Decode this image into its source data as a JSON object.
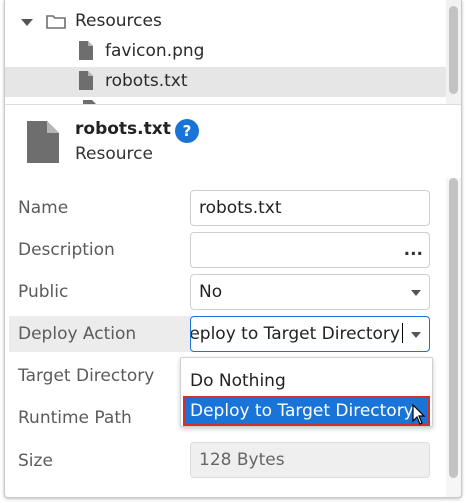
{
  "tree": {
    "items": [
      {
        "label": "Resources",
        "icon": "folder-icon",
        "expanded": true
      },
      {
        "label": "favicon.png",
        "icon": "file-icon"
      },
      {
        "label": "robots.txt",
        "icon": "file-icon",
        "selected": true
      }
    ]
  },
  "header": {
    "title": "robots.txt",
    "subtitle": "Resource",
    "help_label": "?"
  },
  "properties": {
    "name_label": "Name",
    "name_value": "robots.txt",
    "description_label": "Description",
    "description_value": "",
    "description_button": "...",
    "public_label": "Public",
    "public_value": "No",
    "deploy_action_label": "Deploy Action",
    "deploy_action_value": "eploy to Target Directory",
    "target_directory_label": "Target Directory",
    "runtime_path_label": "Runtime Path",
    "size_label": "Size",
    "size_value": "128 Bytes"
  },
  "dropdown": {
    "options": [
      {
        "label": "Do Nothing"
      },
      {
        "label": "Deploy to Target Directory",
        "highlighted": true
      }
    ]
  },
  "colors": {
    "accent": "#1a74d8",
    "highlight_border": "#d32f2f",
    "selected_row": "#e6e6e6"
  }
}
